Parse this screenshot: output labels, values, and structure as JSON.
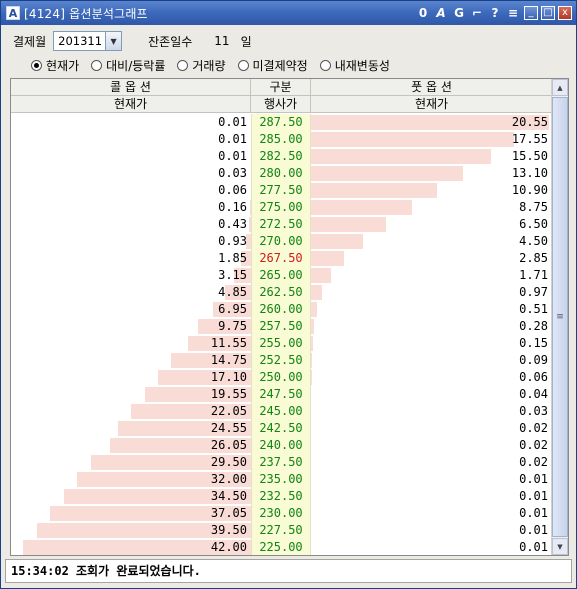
{
  "window": {
    "app_icon": "A",
    "title": "[4124] 옵션분석그래프",
    "tools": [
      {
        "name": "zero-tool-icon",
        "glyph": "0"
      },
      {
        "name": "font-tool-icon",
        "glyph": "A"
      },
      {
        "name": "link-tool-icon",
        "glyph": "G"
      },
      {
        "name": "pin-tool-icon",
        "glyph": "⌐"
      },
      {
        "name": "help-icon",
        "glyph": "?"
      },
      {
        "name": "list-icon",
        "glyph": "≡"
      }
    ],
    "min": "_",
    "max": "□",
    "close": "x"
  },
  "filters": {
    "settlement_label": "결제월",
    "settlement_value": "201311",
    "remaining_label": "잔존일수",
    "remaining_value": "11",
    "remaining_unit": "일",
    "modes": [
      {
        "label": "현재가",
        "selected": true
      },
      {
        "label": "대비/등락률",
        "selected": false
      },
      {
        "label": "거래량",
        "selected": false
      },
      {
        "label": "미결제약정",
        "selected": false
      },
      {
        "label": "내재변동성",
        "selected": false
      }
    ]
  },
  "table": {
    "header1": {
      "call": "콜 옵 션",
      "strike": "구분",
      "put": "풋 옵 션"
    },
    "header2": {
      "call": "현재가",
      "strike": "행사가",
      "put": "현재가"
    },
    "bar_color": "#fadcd6",
    "strike_bg": "#f9fbd5",
    "strike_color": "#128412",
    "atm_color": "#d21b1b",
    "atm_strike": "267.50",
    "rows": [
      {
        "call": "0.01",
        "strike": "287.50",
        "put": "20.55"
      },
      {
        "call": "0.01",
        "strike": "285.00",
        "put": "17.55"
      },
      {
        "call": "0.01",
        "strike": "282.50",
        "put": "15.50"
      },
      {
        "call": "0.03",
        "strike": "280.00",
        "put": "13.10"
      },
      {
        "call": "0.06",
        "strike": "277.50",
        "put": "10.90"
      },
      {
        "call": "0.16",
        "strike": "275.00",
        "put": "8.75"
      },
      {
        "call": "0.43",
        "strike": "272.50",
        "put": "6.50"
      },
      {
        "call": "0.93",
        "strike": "270.00",
        "put": "4.50"
      },
      {
        "call": "1.85",
        "strike": "267.50",
        "put": "2.85"
      },
      {
        "call": "3.15",
        "strike": "265.00",
        "put": "1.71"
      },
      {
        "call": "4.85",
        "strike": "262.50",
        "put": "0.97"
      },
      {
        "call": "6.95",
        "strike": "260.00",
        "put": "0.51"
      },
      {
        "call": "9.75",
        "strike": "257.50",
        "put": "0.28"
      },
      {
        "call": "11.55",
        "strike": "255.00",
        "put": "0.15"
      },
      {
        "call": "14.75",
        "strike": "252.50",
        "put": "0.09"
      },
      {
        "call": "17.10",
        "strike": "250.00",
        "put": "0.06"
      },
      {
        "call": "19.55",
        "strike": "247.50",
        "put": "0.04"
      },
      {
        "call": "22.05",
        "strike": "245.00",
        "put": "0.03"
      },
      {
        "call": "24.55",
        "strike": "242.50",
        "put": "0.02"
      },
      {
        "call": "26.05",
        "strike": "240.00",
        "put": "0.02"
      },
      {
        "call": "29.50",
        "strike": "237.50",
        "put": "0.02"
      },
      {
        "call": "32.00",
        "strike": "235.00",
        "put": "0.01"
      },
      {
        "call": "34.50",
        "strike": "232.50",
        "put": "0.01"
      },
      {
        "call": "37.05",
        "strike": "230.00",
        "put": "0.01"
      },
      {
        "call": "39.50",
        "strike": "227.50",
        "put": "0.01"
      },
      {
        "call": "42.00",
        "strike": "225.00",
        "put": "0.01"
      }
    ]
  },
  "scrollbar": {
    "up": "▲",
    "down": "▼",
    "grip": "≡"
  },
  "status": {
    "text": "15:34:02 조회가 완료되었습니다."
  }
}
